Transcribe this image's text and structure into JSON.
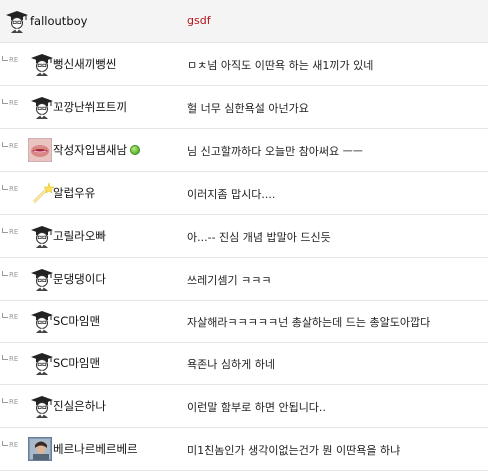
{
  "post": {
    "author": "falloutboy",
    "text": "gsdf"
  },
  "re_label": "RE",
  "comments": [
    {
      "author": "뻥신새끼뻥씬",
      "text": "ㅁㅊ넘 아직도 이딴욕 하는 새1끼가 있네",
      "avatar": "graduate-avatar",
      "online": false
    },
    {
      "author": "꼬깡난쒸프트끼",
      "text": "헐 너무 심한욕설 아넌가요",
      "avatar": "graduate-avatar",
      "online": false
    },
    {
      "author": "작성자입냄새남",
      "text": "님 신고할까하다 오늘만 참아써요 ㅡㅡ",
      "avatar": "photo-avatar",
      "online": true
    },
    {
      "author": "알럽우유",
      "text": "이러지좀 맙시다....",
      "avatar": "wand-avatar",
      "online": false
    },
    {
      "author": "고릴라오빠",
      "text": "아...-- 진심 개념 밥말아 드신듯",
      "avatar": "graduate-avatar",
      "online": false
    },
    {
      "author": "문댕댕이다",
      "text": "쓰레기셈기 ㅋㅋㅋ",
      "avatar": "graduate-avatar",
      "online": false
    },
    {
      "author": "SC마임맨",
      "text": "자살해라ㅋㅋㅋㅋㅋ넌 총살하는데 드는 총알도아깝다",
      "avatar": "graduate-avatar",
      "online": false
    },
    {
      "author": "SC마임맨",
      "text": "욕존나 심하게 하네",
      "avatar": "graduate-avatar",
      "online": false
    },
    {
      "author": "진실은하나",
      "text": "이런말 함부로 하면 안됩니다..",
      "avatar": "graduate-avatar",
      "online": false
    },
    {
      "author": "베르나르베르베르",
      "text": "미1친놈인가 생각이없는건가 뭔 이딴욕을 하냐",
      "avatar": "photo-avatar-2",
      "online": false
    }
  ]
}
